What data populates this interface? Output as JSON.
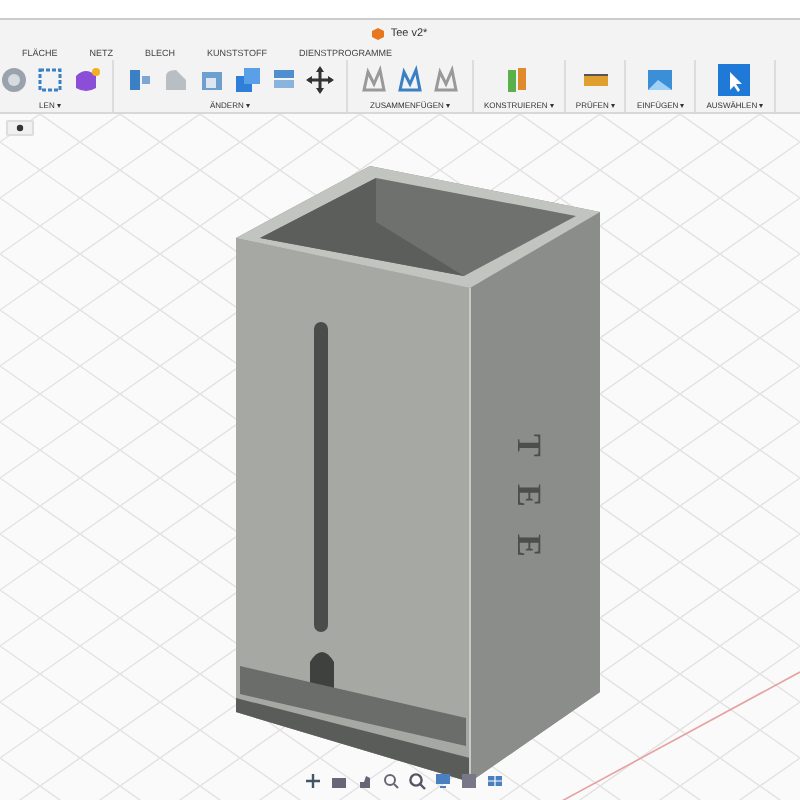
{
  "window": {
    "title": "Tee v2*"
  },
  "tabs": [
    {
      "label": "FLÄCHE"
    },
    {
      "label": "NETZ"
    },
    {
      "label": "BLECH"
    },
    {
      "label": "KUNSTSTOFF"
    },
    {
      "label": "DIENSTPROGRAMME"
    }
  ],
  "toolbar_groups": [
    {
      "label": "LEN ▾"
    },
    {
      "label": "ÄNDERN ▾"
    },
    {
      "label": "ZUSAMMENFÜGEN ▾"
    },
    {
      "label": "KONSTRUIEREN ▾"
    },
    {
      "label": "PRÜFEN ▾"
    },
    {
      "label": "EINFÜGEN ▾"
    },
    {
      "label": "AUSWÄHLEN ▾"
    }
  ],
  "model": {
    "engraving": "TEE"
  }
}
